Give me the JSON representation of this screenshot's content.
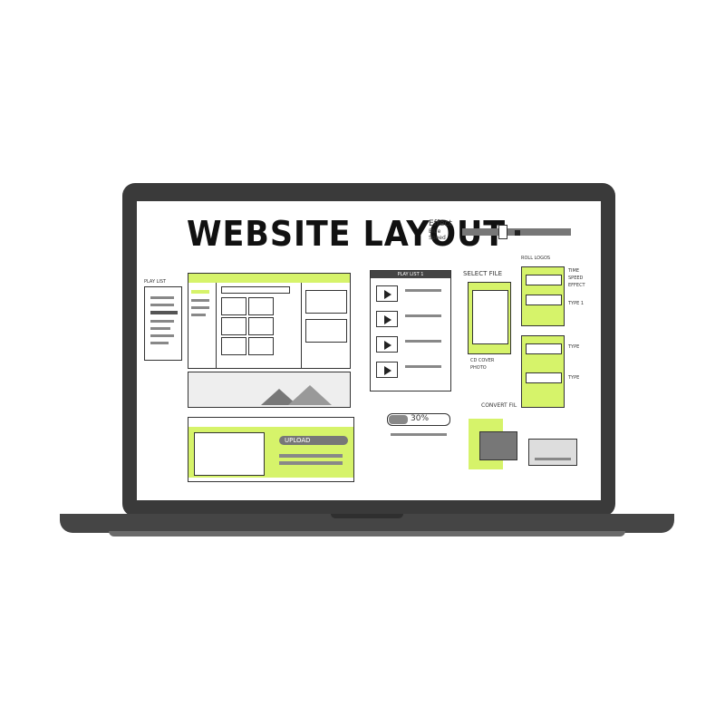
{
  "title": "WEBSITE LAYOUT",
  "effect_note": {
    "heading": "Effect",
    "items": [
      "Blue",
      "Speed"
    ]
  },
  "playlist_label": "PLAY LIST",
  "playlist_panel_title": "PLAY LIST 1",
  "select_file": {
    "label": "SELECT FILE",
    "items": [
      "CD COVER",
      "PHOTO"
    ]
  },
  "right_notes": {
    "top": [
      "ROLL LOGOS",
      "TIME",
      "SPEED",
      "EFFECT"
    ],
    "side": [
      "TYPE 1",
      "TYPE",
      "TYPE"
    ]
  },
  "upload_label": "UPLOAD",
  "progress_label": "30%",
  "convert_label": "CONVERT FIL",
  "colors": {
    "accent": "#d6f36a",
    "frame": "#3a3a3a",
    "ink": "#333333"
  }
}
